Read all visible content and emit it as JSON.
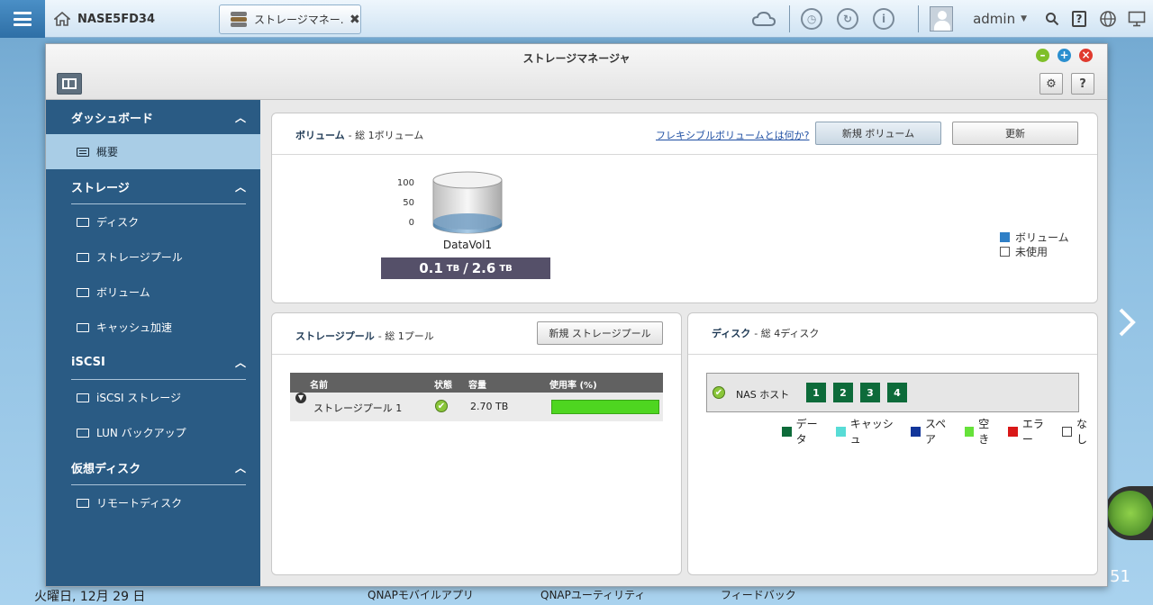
{
  "topbar": {
    "host_name": "NASE5FD34",
    "app_tab_label": "ストレージマネー...",
    "app_tab_close": "✖",
    "user": "admin",
    "caret": "▼",
    "help_glyph": "?"
  },
  "window": {
    "title": "ストレージマネージャ",
    "gear_glyph": "⚙",
    "help_glyph": "?"
  },
  "sidebar": {
    "sections": [
      {
        "title": "ダッシュボード",
        "items": [
          {
            "label": "概要",
            "active": true
          }
        ]
      },
      {
        "title": "ストレージ",
        "items": [
          {
            "label": "ディスク"
          },
          {
            "label": "ストレージプール"
          },
          {
            "label": "ボリューム"
          },
          {
            "label": "キャッシュ加速"
          }
        ]
      },
      {
        "title": "iSCSI",
        "items": [
          {
            "label": "iSCSI ストレージ"
          },
          {
            "label": "LUN バックアップ"
          }
        ]
      },
      {
        "title": "仮想ディスク",
        "items": [
          {
            "label": "リモートディスク"
          }
        ]
      }
    ]
  },
  "volume_panel": {
    "title": "ボリューム",
    "subtitle": "- 総 1ボリューム",
    "link": "フレキシブルボリュームとは何か?",
    "new_button": "新規 ボリューム",
    "refresh_button": "更新",
    "axis": [
      "100",
      "50",
      "0"
    ],
    "volume_name": "DataVol1",
    "used": "0.1",
    "total": "2.6",
    "unit": "TB",
    "used_fraction": 0.04,
    "legend": [
      {
        "label": "ボリューム",
        "color": "#2f7fc6"
      },
      {
        "label": "未使用",
        "color": "#ffffff"
      }
    ]
  },
  "pool_panel": {
    "title": "ストレージプール",
    "subtitle": "- 総 1プール",
    "new_button": "新規 ストレージプール",
    "columns": [
      "名前",
      "状態",
      "容量",
      "使用率 (%)"
    ],
    "rows": [
      {
        "name": "ストレージプール 1",
        "status": "✔",
        "capacity": "2.70 TB",
        "usage_fraction": 1.0
      }
    ]
  },
  "disk_panel": {
    "title": "ディスク",
    "subtitle": "- 総 4ディスク",
    "host_label": "NAS ホスト",
    "disks": [
      "1",
      "2",
      "3",
      "4"
    ],
    "legend": [
      {
        "label": "データ",
        "color": "#0d6b3a"
      },
      {
        "label": "キャッシュ",
        "color": "#58dcd6"
      },
      {
        "label": "スペア",
        "color": "#12369a"
      },
      {
        "label": "空き",
        "color": "#66e23a"
      },
      {
        "label": "エラー",
        "color": "#d91818"
      },
      {
        "label": "なし",
        "color": "#ffffff"
      }
    ]
  },
  "bottom": {
    "date_fragment": "火曜日, 12月 29 日",
    "links": [
      "QNAPモバイルアプリ",
      "QNAPユーティリティ",
      "フィードバック"
    ],
    "clock_fragment": "51"
  }
}
